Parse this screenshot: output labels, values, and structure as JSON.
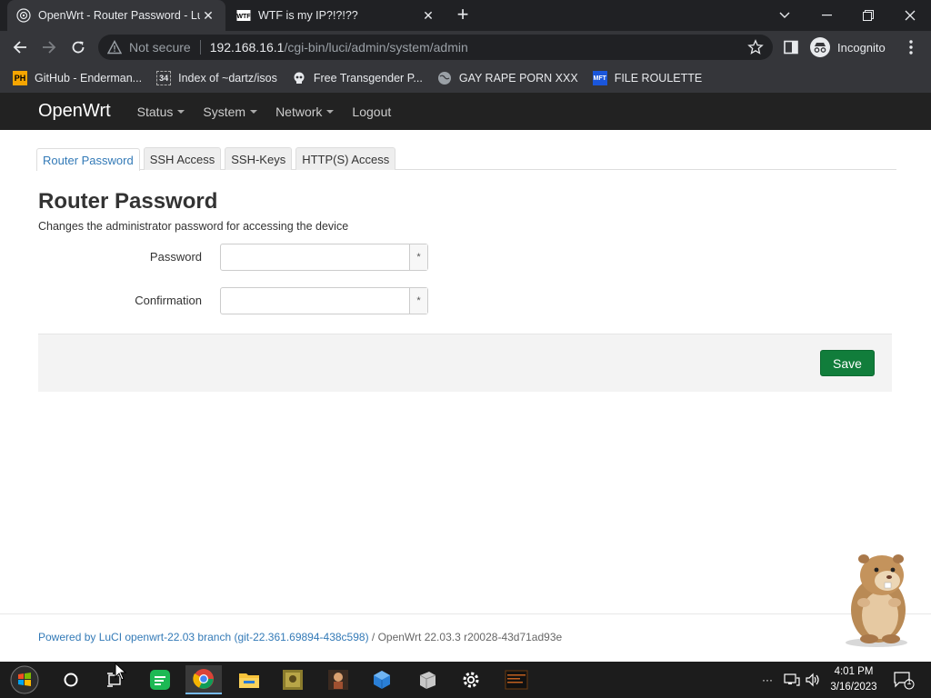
{
  "browser": {
    "tabs": [
      {
        "title": "OpenWrt - Router Password - LuCI",
        "favicon": "openwrt-icon",
        "active": true
      },
      {
        "title": "WTF is my IP?!?!??",
        "favicon": "wtf-icon",
        "active": false
      }
    ],
    "address": {
      "security_label": "Not secure",
      "host": "192.168.16.1",
      "path": "/cgi-bin/luci/admin/system/admin"
    },
    "profile_label": "Incognito",
    "bookmarks": [
      {
        "label": "GitHub - Enderman...",
        "icon": "ph-icon",
        "icon_text": "PH",
        "color": "#f7a600"
      },
      {
        "label": "Index of ~dartz/isos",
        "icon": "folder-34-icon",
        "icon_text": "34",
        "color": "#e8eaed"
      },
      {
        "label": "Free Transgender P...",
        "icon": "skull-icon",
        "icon_text": "",
        "color": "#e8eaed"
      },
      {
        "label": "GAY RAPE PORN XXX",
        "icon": "globe-icon",
        "icon_text": "",
        "color": "#9aa0a6"
      },
      {
        "label": "FILE ROULETTE",
        "icon": "mft-icon",
        "icon_text": "MFT",
        "color": "#1a56db"
      }
    ]
  },
  "openwrt": {
    "brand": "OpenWrt",
    "menu": [
      {
        "label": "Status",
        "dropdown": true
      },
      {
        "label": "System",
        "dropdown": true
      },
      {
        "label": "Network",
        "dropdown": true
      },
      {
        "label": "Logout",
        "dropdown": false
      }
    ],
    "tabs": [
      {
        "label": "Router Password",
        "active": true
      },
      {
        "label": "SSH Access",
        "active": false
      },
      {
        "label": "SSH-Keys",
        "active": false
      },
      {
        "label": "HTTP(S) Access",
        "active": false
      }
    ],
    "title": "Router Password",
    "description": "Changes the administrator password for accessing the device",
    "fields": [
      {
        "label": "Password",
        "value": "",
        "reveal": "*"
      },
      {
        "label": "Confirmation",
        "value": "",
        "reveal": "*"
      }
    ],
    "save_label": "Save",
    "footer": {
      "link_text": "Powered by LuCI openwrt-22.03 branch (git-22.361.69894-438c598)",
      "rest": " / OpenWrt 22.03.3 r20028-43d71ad93e"
    }
  },
  "taskbar": {
    "clock_time": "4:01 PM",
    "clock_date": "3/16/2023",
    "notification_count": "1",
    "tray_overflow": "···"
  }
}
